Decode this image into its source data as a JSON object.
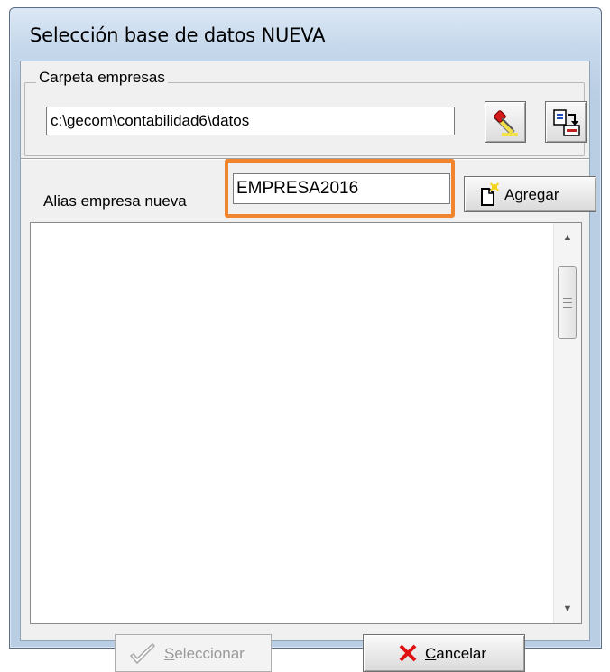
{
  "window": {
    "title": "Selección base de datos NUEVA"
  },
  "folder_group": {
    "legend": "Carpeta empresas",
    "path_value": "c:\\gecom\\contabilidad6\\datos",
    "browse_icon": "flashlight-icon",
    "export_icon": "copy-export-icon"
  },
  "alias": {
    "label": "Alias empresa nueva",
    "value": "EMPRESA2016",
    "highlight_color": "#f0852d"
  },
  "add_button": {
    "label": "Agregar",
    "icon": "new-document-icon"
  },
  "list": {
    "items": []
  },
  "footer": {
    "select_label_first": "S",
    "select_label_rest": "eleccionar",
    "select_enabled": false,
    "cancel_label_first": "C",
    "cancel_label_rest": "ancelar"
  }
}
